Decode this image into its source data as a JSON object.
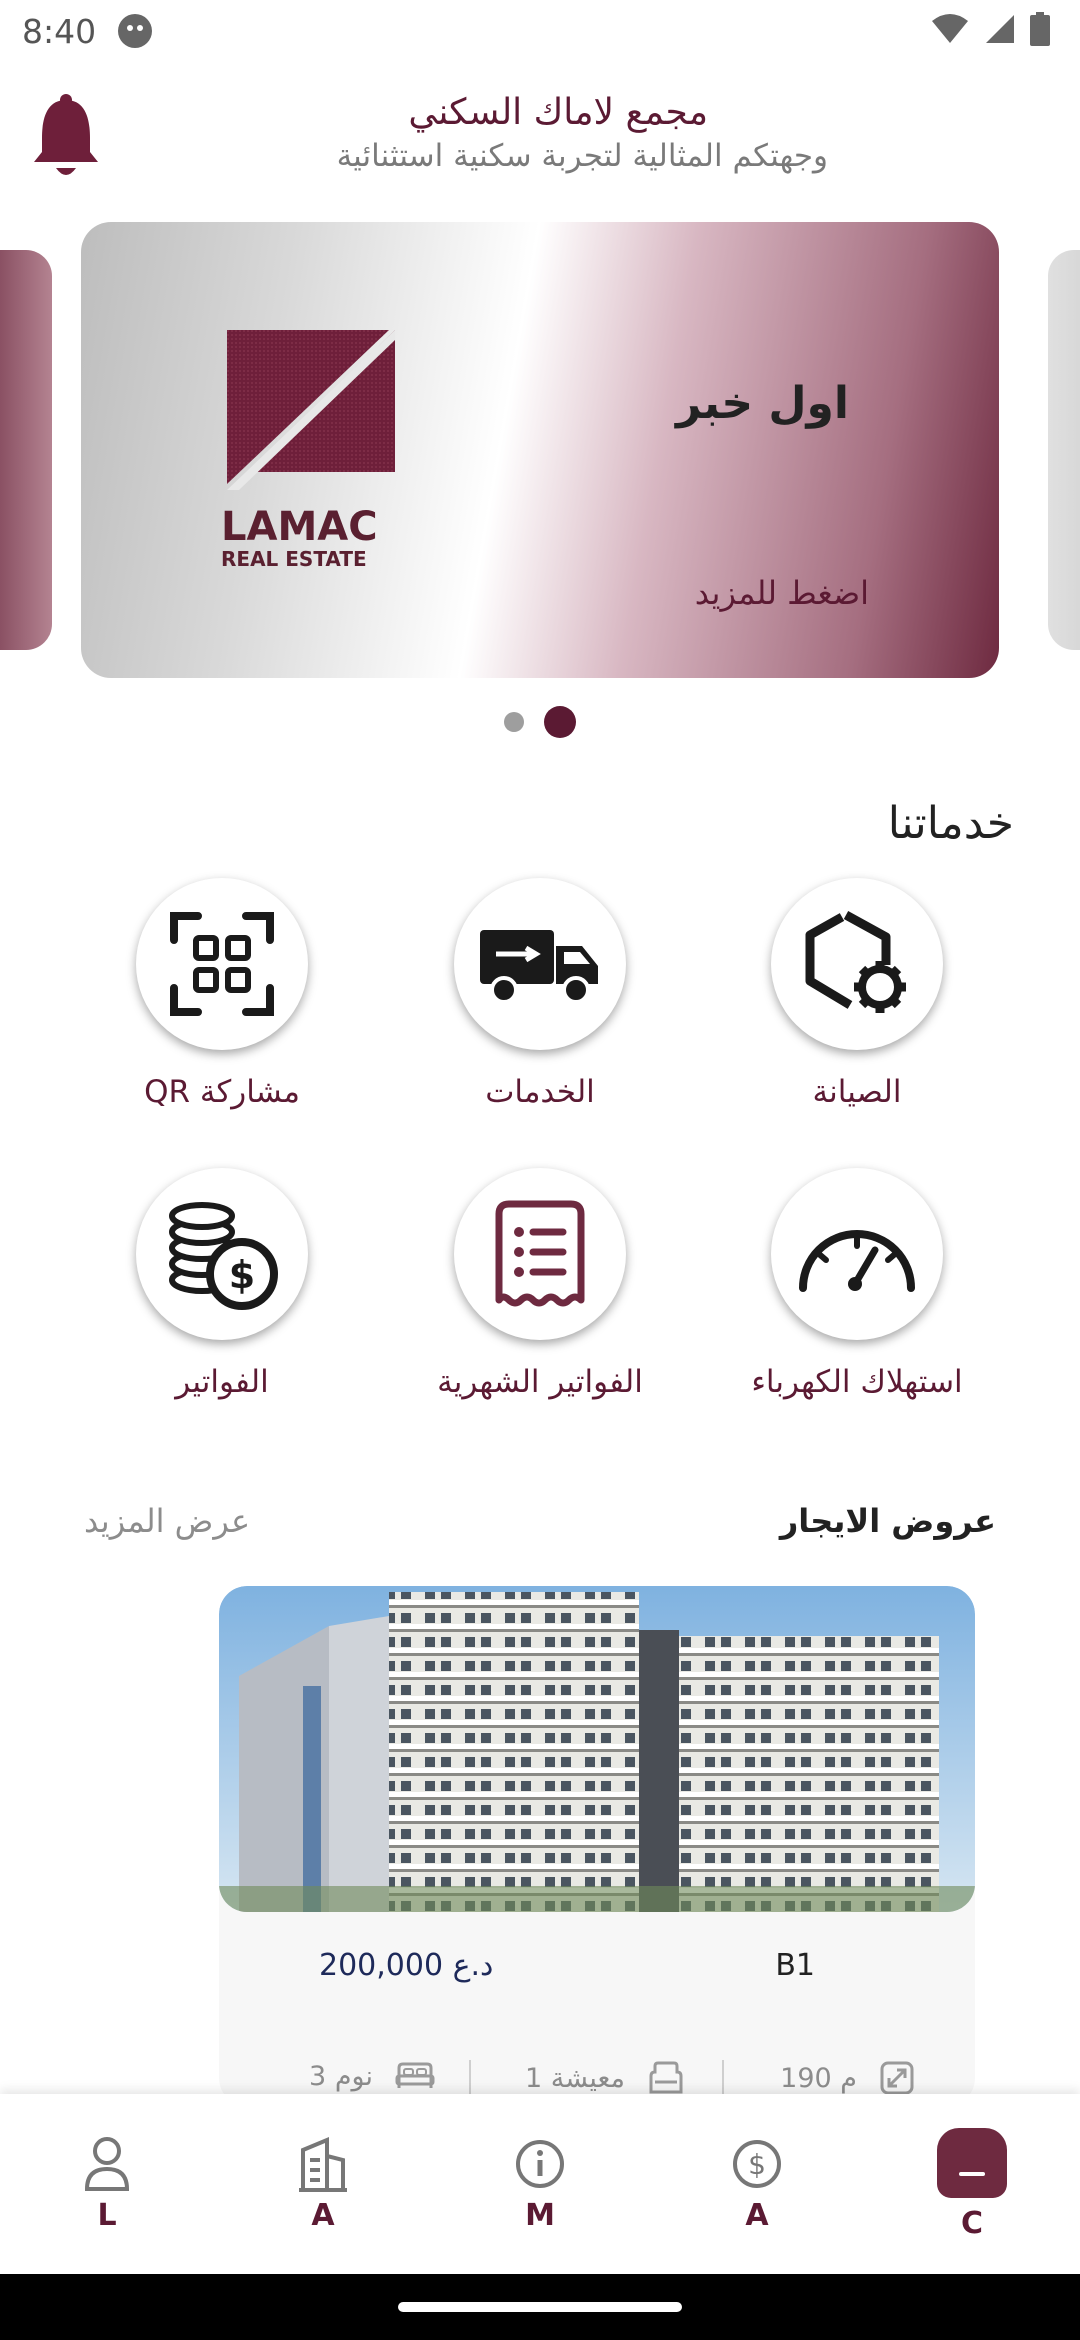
{
  "status_bar": {
    "time": "8:40"
  },
  "header": {
    "title": "مجمع لاماك السكني",
    "subtitle": "وجهتكم المثالية لتجربة سكنية استثنائية"
  },
  "carousel": {
    "card_title": "اول خبر",
    "card_more": "اضغط للمزيد",
    "logo_text_main": "LAMAC",
    "logo_text_sub": "REAL ESTATE",
    "active_index": 1,
    "count": 2
  },
  "services": {
    "title": "خدماتنا",
    "items": [
      {
        "label": "الصيانة",
        "icon": "maintenance-gear-icon"
      },
      {
        "label": "الخدمات",
        "icon": "delivery-truck-icon"
      },
      {
        "label": "مشاركة  QR",
        "icon": "qr-scan-icon"
      },
      {
        "label": "استهلاك الكهرباء",
        "icon": "gauge-icon"
      },
      {
        "label": "الفواتير الشهرية",
        "icon": "receipt-icon"
      },
      {
        "label": "الفواتير",
        "icon": "coins-icon"
      }
    ]
  },
  "rentals": {
    "title": "عروض الايجار",
    "more": "عرض المزيد",
    "card": {
      "price": "200,000 د.ع",
      "unit": "B1",
      "area": "190 م",
      "living": "1 معيشة",
      "bedrooms": "3 نوم"
    }
  },
  "bottom_nav": {
    "items": [
      {
        "label": "L",
        "icon": "person-icon"
      },
      {
        "label": "A",
        "icon": "building-icon"
      },
      {
        "label": "M",
        "icon": "info-icon"
      },
      {
        "label": "A",
        "icon": "dollar-icon"
      },
      {
        "label": "C",
        "icon": "home-tab-icon",
        "active": true
      }
    ]
  },
  "colors": {
    "accent": "#5b1a33",
    "accent_light": "#6e2a40",
    "price": "#1e2a5a"
  }
}
